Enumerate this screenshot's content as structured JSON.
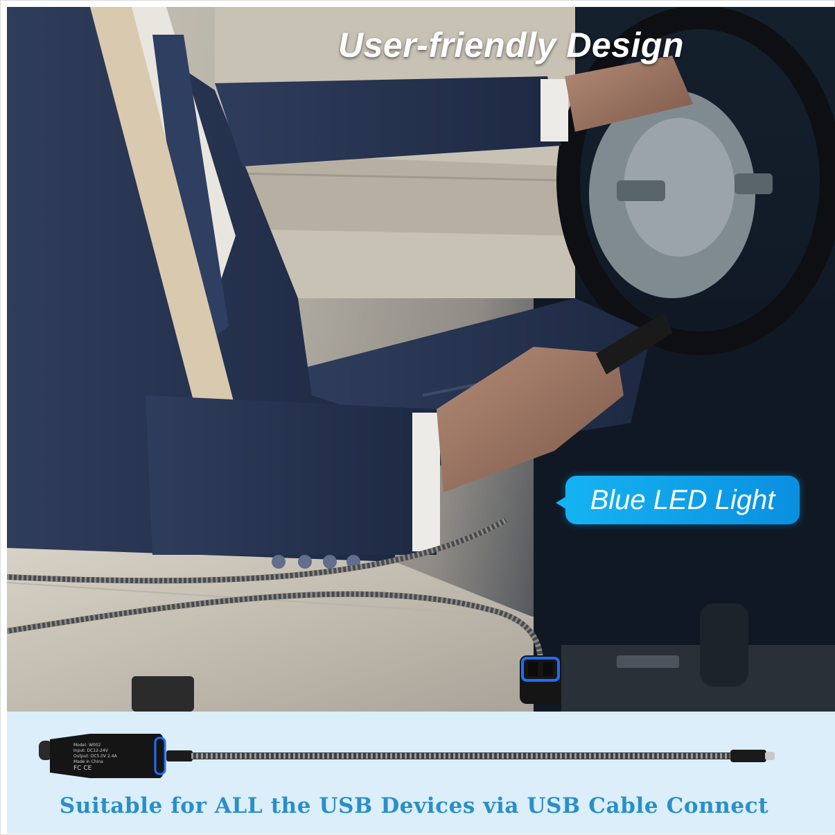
{
  "headline": "User-friendly Design",
  "callout": "Blue LED Light",
  "caption": "Suitable for ALL the USB Devices via USB Cable Connect",
  "product_label": {
    "line1": "Model: W002",
    "line2": "Input: DC12-24V",
    "line3": "Output: DC5.0V 2.4A",
    "line4": "Made in China",
    "marks": "FC CE"
  },
  "colors": {
    "callout": "#15b3f2",
    "caption": "#2a8fc7",
    "strip_background": "#dbeef9",
    "suit": "#2a3a5c",
    "led": "#1f6dff"
  }
}
